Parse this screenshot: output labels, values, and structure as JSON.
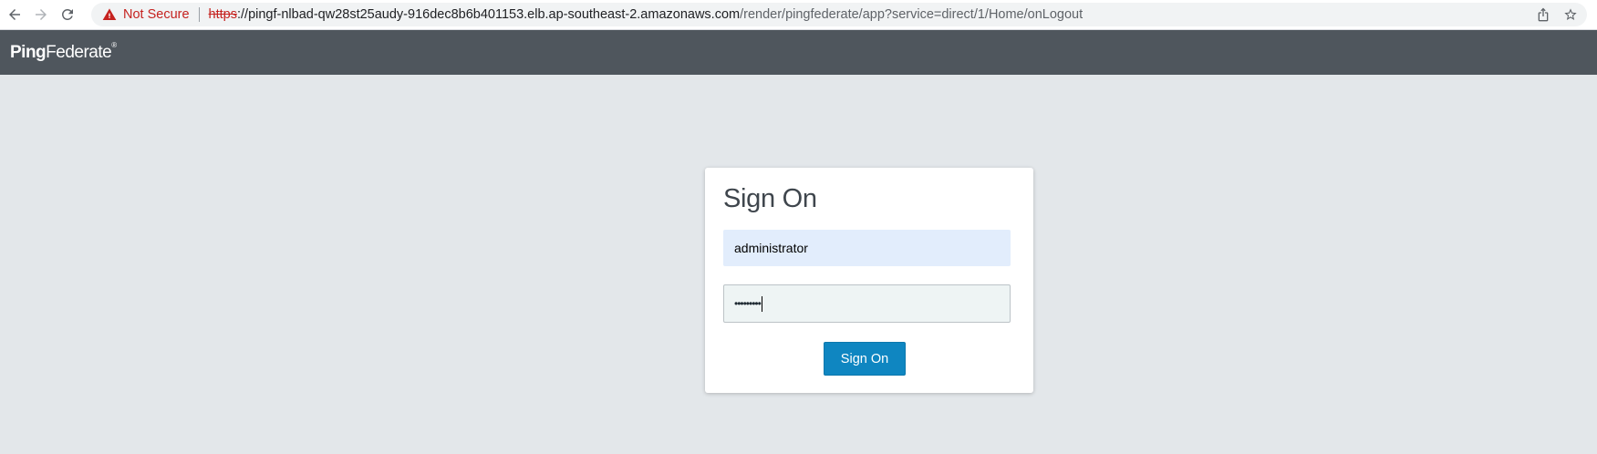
{
  "browser": {
    "security_label": "Not Secure",
    "url_scheme": "https",
    "url_separator": "://",
    "url_host": "pingf-nlbad-qw28st25audy-916dec8b6b401153.elb.ap-southeast-2.amazonaws.com",
    "url_path": "/render/pingfederate/app?service=direct/1/Home/onLogout"
  },
  "app": {
    "logo_part1": "Ping",
    "logo_part2": "Federate",
    "logo_mark": "®"
  },
  "login": {
    "title": "Sign On",
    "username_value": "administrator",
    "password_masked": "•••••••••",
    "submit_label": "Sign On"
  },
  "colors": {
    "header_bg": "#4f565d",
    "page_bg": "#e3e7ea",
    "button_bg": "#0f86c1",
    "warning": "#c5221f"
  }
}
